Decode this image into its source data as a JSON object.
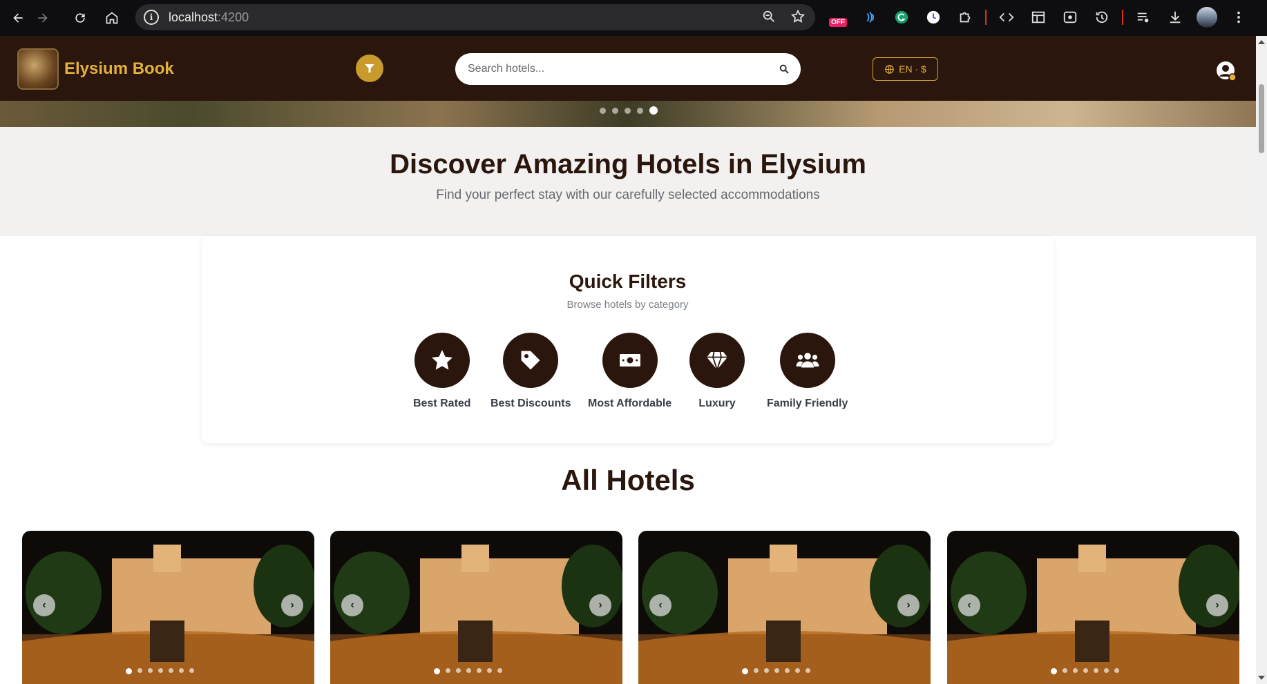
{
  "browser": {
    "url_host": "localhost",
    "url_port": ":4200",
    "extension_badge": "OFF"
  },
  "header": {
    "brand": "Elysium Book",
    "search_placeholder": "Search hotels...",
    "lang_currency": "EN · $"
  },
  "hero": {
    "slide_count": 5,
    "active_slide": 5
  },
  "intro": {
    "title": "Discover Amazing Hotels in Elysium",
    "subtitle": "Find your perfect stay with our carefully selected accommodations"
  },
  "quick_filters": {
    "title": "Quick Filters",
    "subtitle": "Browse hotels by category",
    "items": [
      {
        "label": "Best Rated",
        "icon": "star-icon"
      },
      {
        "label": "Best Discounts",
        "icon": "tag-icon"
      },
      {
        "label": "Most Affordable",
        "icon": "money-icon"
      },
      {
        "label": "Luxury",
        "icon": "diamond-icon"
      },
      {
        "label": "Family Friendly",
        "icon": "users-icon"
      }
    ]
  },
  "hotels": {
    "title": "All Hotels",
    "card_count": 4
  },
  "colors": {
    "brand_dark": "#2a160c",
    "brand_gold": "#e3b23c"
  }
}
